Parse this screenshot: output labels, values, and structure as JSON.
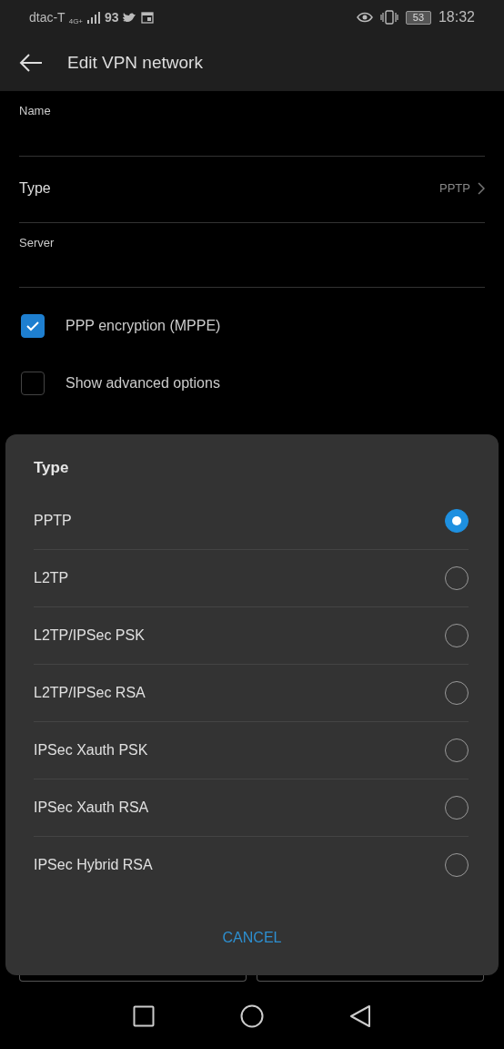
{
  "status_bar": {
    "carrier": "dtac-T",
    "network": "4G+",
    "notification_count": "93",
    "battery": "53",
    "time": "18:32"
  },
  "app_bar": {
    "title": "Edit VPN network"
  },
  "form": {
    "name": {
      "label": "Name"
    },
    "type": {
      "label": "Type",
      "value": "PPTP"
    },
    "server": {
      "label": "Server"
    },
    "checkboxes": [
      {
        "label": "PPP encryption (MPPE)",
        "checked": true
      },
      {
        "label": "Show advanced options",
        "checked": false
      }
    ]
  },
  "dialog": {
    "title": "Type",
    "options": [
      {
        "label": "PPTP",
        "selected": true
      },
      {
        "label": "L2TP",
        "selected": false
      },
      {
        "label": "L2TP/IPSec PSK",
        "selected": false
      },
      {
        "label": "L2TP/IPSec RSA",
        "selected": false
      },
      {
        "label": "IPSec Xauth PSK",
        "selected": false
      },
      {
        "label": "IPSec Xauth RSA",
        "selected": false
      },
      {
        "label": "IPSec Hybrid RSA",
        "selected": false
      }
    ],
    "cancel": "CANCEL"
  }
}
